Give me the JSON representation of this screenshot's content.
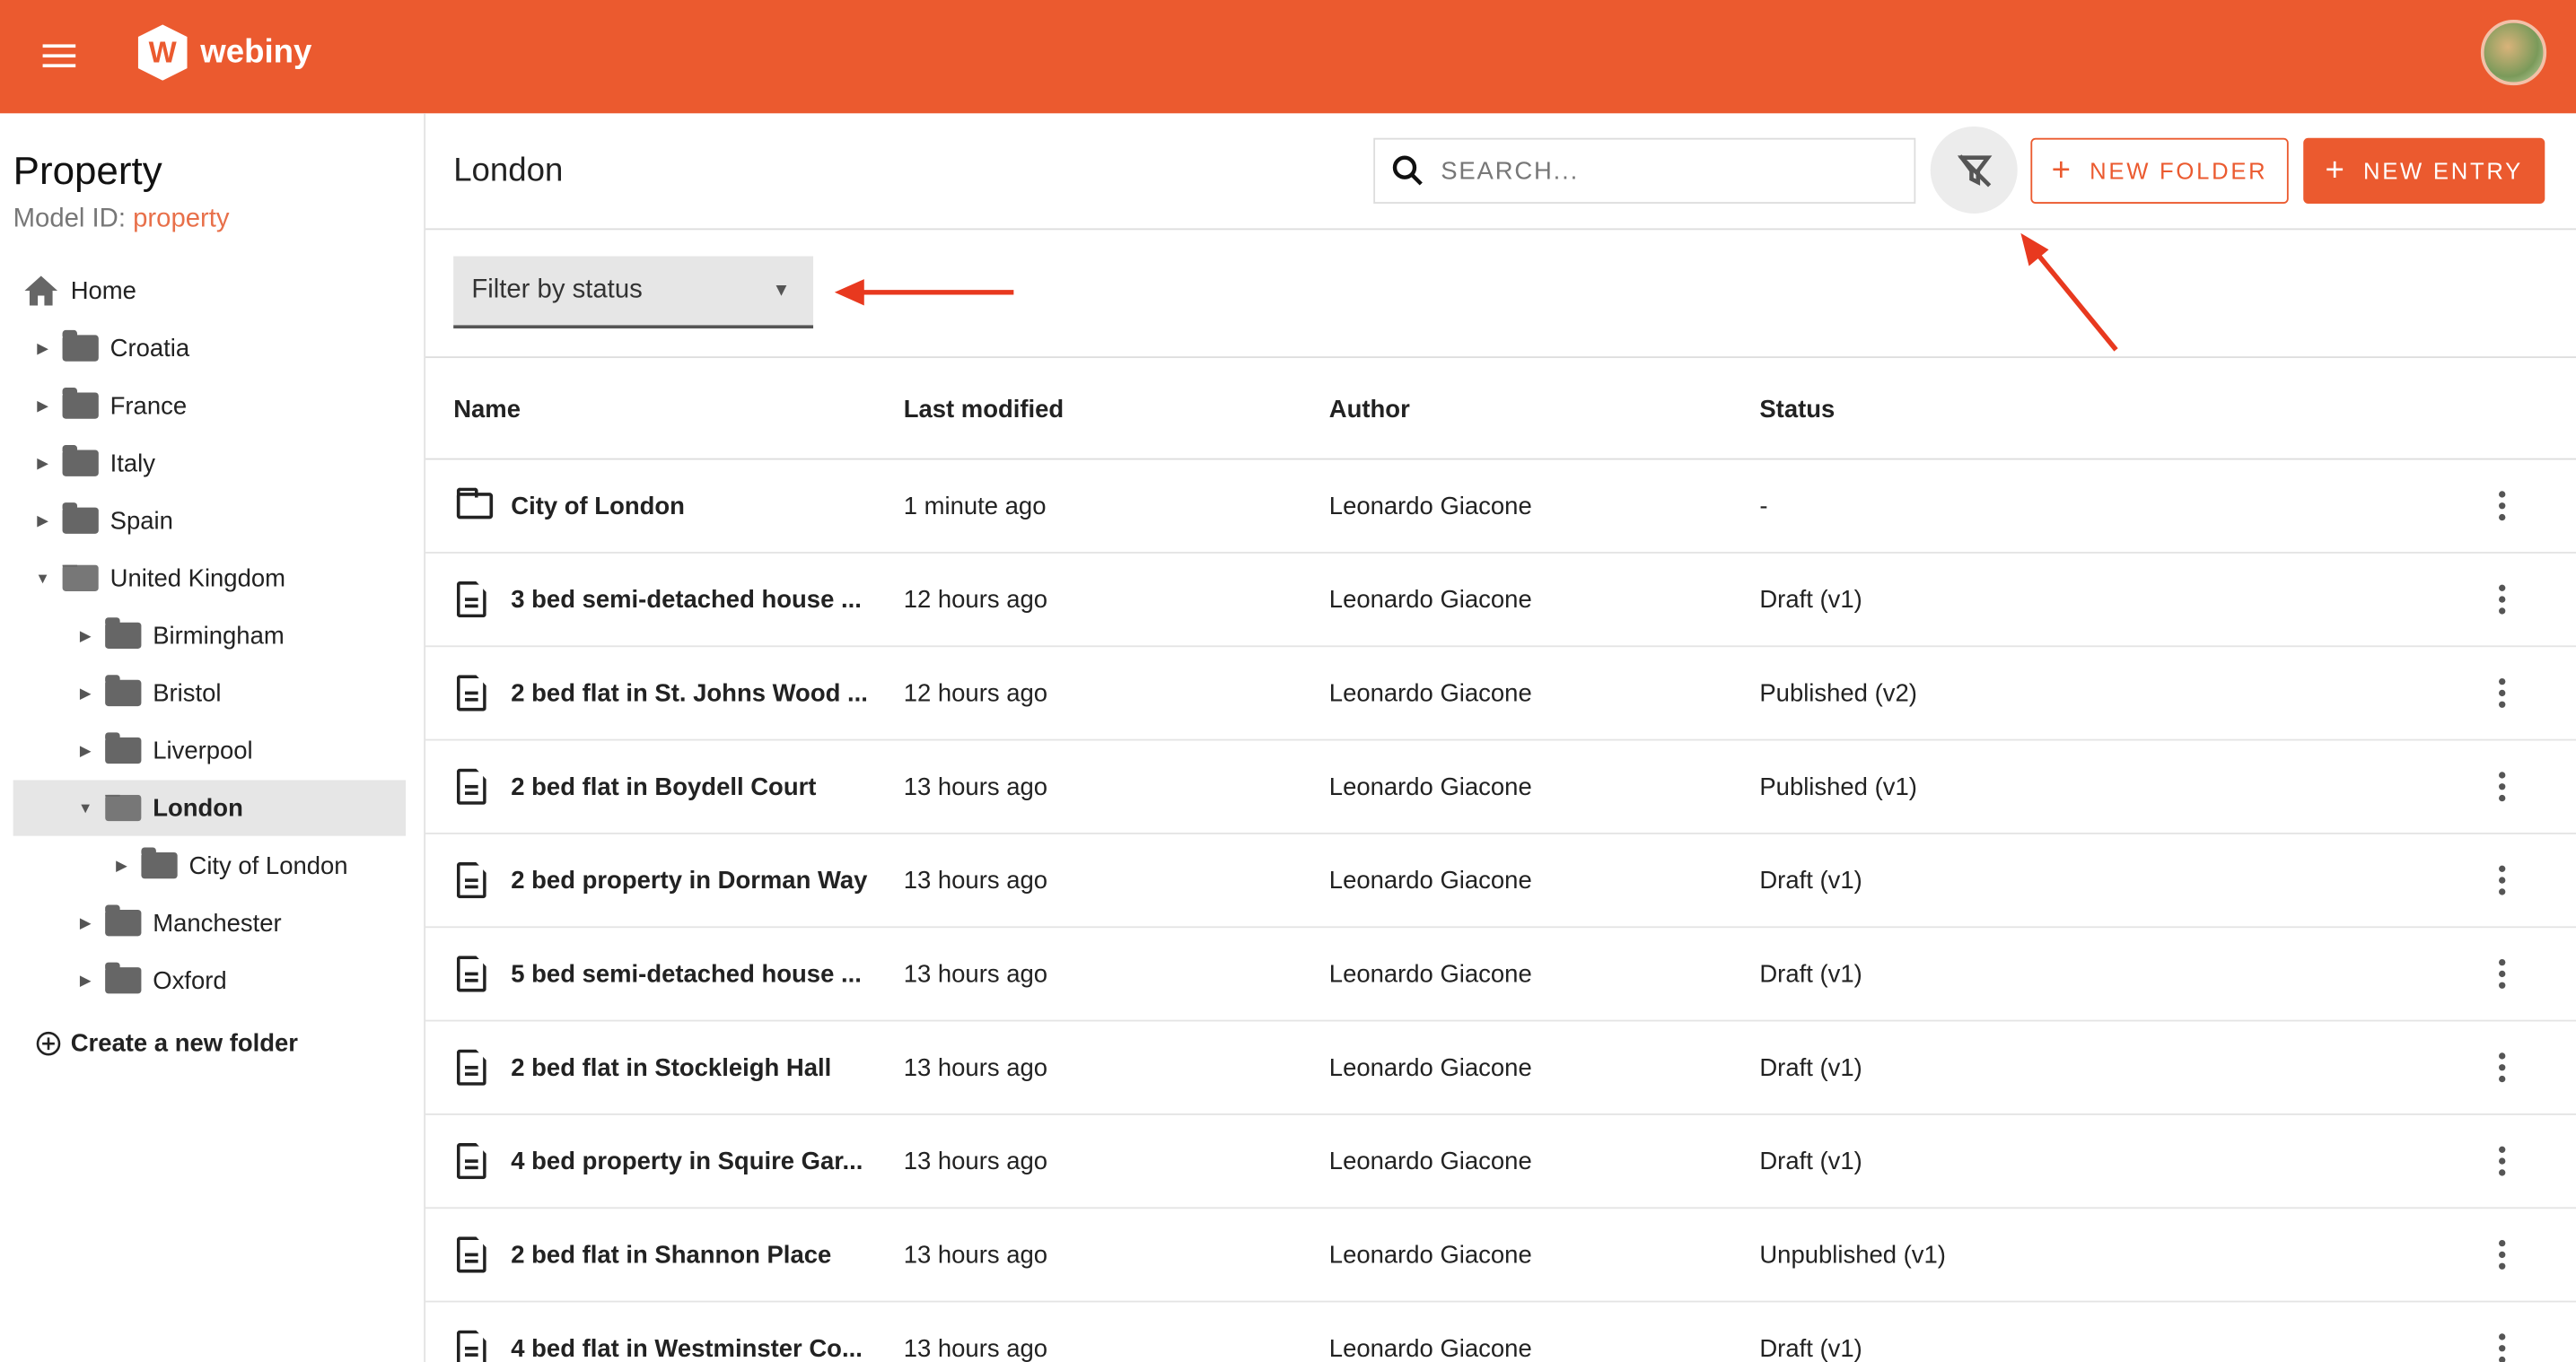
{
  "header": {
    "logo_text": "webiny",
    "logo_letter": "W",
    "accent": "#eb5a2f"
  },
  "sidebar": {
    "title": "Property",
    "model_label": "Model ID:",
    "model_id": "property",
    "home": "Home",
    "tree": [
      {
        "label": "Croatia",
        "level": 1,
        "expanded": false
      },
      {
        "label": "France",
        "level": 1,
        "expanded": false
      },
      {
        "label": "Italy",
        "level": 1,
        "expanded": false
      },
      {
        "label": "Spain",
        "level": 1,
        "expanded": false
      },
      {
        "label": "United Kingdom",
        "level": 1,
        "expanded": true
      },
      {
        "label": "Birmingham",
        "level": 2,
        "expanded": false
      },
      {
        "label": "Bristol",
        "level": 2,
        "expanded": false
      },
      {
        "label": "Liverpool",
        "level": 2,
        "expanded": false
      },
      {
        "label": "London",
        "level": 2,
        "expanded": true,
        "selected": true
      },
      {
        "label": "City of London",
        "level": 3,
        "expanded": false
      },
      {
        "label": "Manchester",
        "level": 2,
        "expanded": false
      },
      {
        "label": "Oxford",
        "level": 2,
        "expanded": false
      }
    ],
    "create_folder": "Create a new folder"
  },
  "main": {
    "title": "London",
    "search_placeholder": "SEARCH...",
    "new_folder": "NEW FOLDER",
    "new_entry": "NEW ENTRY",
    "status_filter": "Filter by status",
    "columns": [
      "Name",
      "Last modified",
      "Author",
      "Status"
    ],
    "rows": [
      {
        "type": "folder",
        "name": "City of London",
        "modified": "1 minute ago",
        "author": "Leonardo Giacone",
        "status": "-"
      },
      {
        "type": "entry",
        "name": "3 bed semi-detached house ...",
        "modified": "12 hours ago",
        "author": "Leonardo Giacone",
        "status": "Draft (v1)"
      },
      {
        "type": "entry",
        "name": "2 bed flat in St. Johns Wood ...",
        "modified": "12 hours ago",
        "author": "Leonardo Giacone",
        "status": "Published (v2)"
      },
      {
        "type": "entry",
        "name": "2 bed flat in Boydell Court",
        "modified": "13 hours ago",
        "author": "Leonardo Giacone",
        "status": "Published (v1)"
      },
      {
        "type": "entry",
        "name": "2 bed property in Dorman Way",
        "modified": "13 hours ago",
        "author": "Leonardo Giacone",
        "status": "Draft (v1)"
      },
      {
        "type": "entry",
        "name": "5 bed semi-detached house ...",
        "modified": "13 hours ago",
        "author": "Leonardo Giacone",
        "status": "Draft (v1)"
      },
      {
        "type": "entry",
        "name": "2 bed flat in Stockleigh Hall",
        "modified": "13 hours ago",
        "author": "Leonardo Giacone",
        "status": "Draft (v1)"
      },
      {
        "type": "entry",
        "name": "4 bed property in Squire Gar...",
        "modified": "13 hours ago",
        "author": "Leonardo Giacone",
        "status": "Draft (v1)"
      },
      {
        "type": "entry",
        "name": "2 bed flat in Shannon Place",
        "modified": "13 hours ago",
        "author": "Leonardo Giacone",
        "status": "Unpublished (v1)"
      },
      {
        "type": "entry",
        "name": "4 bed flat in Westminster Co...",
        "modified": "13 hours ago",
        "author": "Leonardo Giacone",
        "status": "Draft (v1)"
      }
    ]
  }
}
